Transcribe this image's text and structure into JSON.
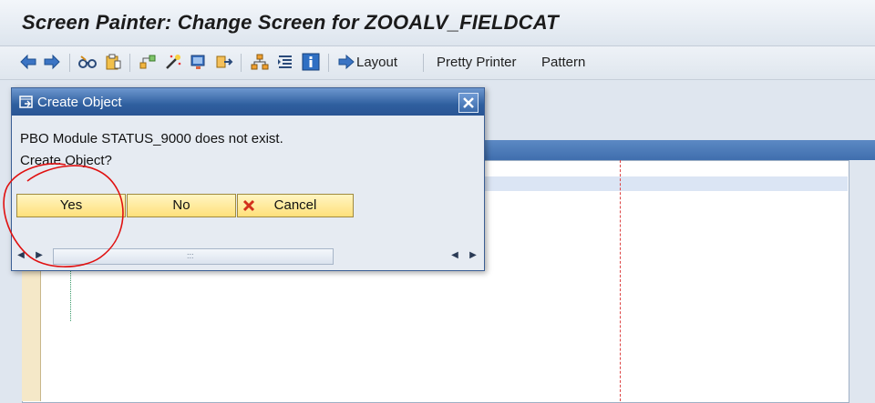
{
  "window": {
    "title": "Screen Painter: Change Screen for ZOOALV_FIELDCAT"
  },
  "toolbar": {
    "icons": [
      "back-arrow-icon",
      "forward-arrow-icon",
      "glasses-icon",
      "clipboard-icon",
      "hierarchy-icon",
      "magic-wand-icon",
      "screen-icon",
      "transfer-icon",
      "tree-icon",
      "indent-icon",
      "info-icon"
    ],
    "layout_label": "Layout",
    "pretty_printer_label": "Pretty Printer",
    "pattern_label": "Pattern"
  },
  "dialog": {
    "title": "Create Object",
    "message_line1": "PBO Module STATUS_9000 does not exist.",
    "message_line2": "Create Object?",
    "buttons": {
      "yes": "Yes",
      "no": "No",
      "cancel": "Cancel"
    }
  },
  "colors": {
    "dialog_title": "#2f5f9f",
    "button_fill": "#ffe07a",
    "annotation": "#e01010"
  }
}
